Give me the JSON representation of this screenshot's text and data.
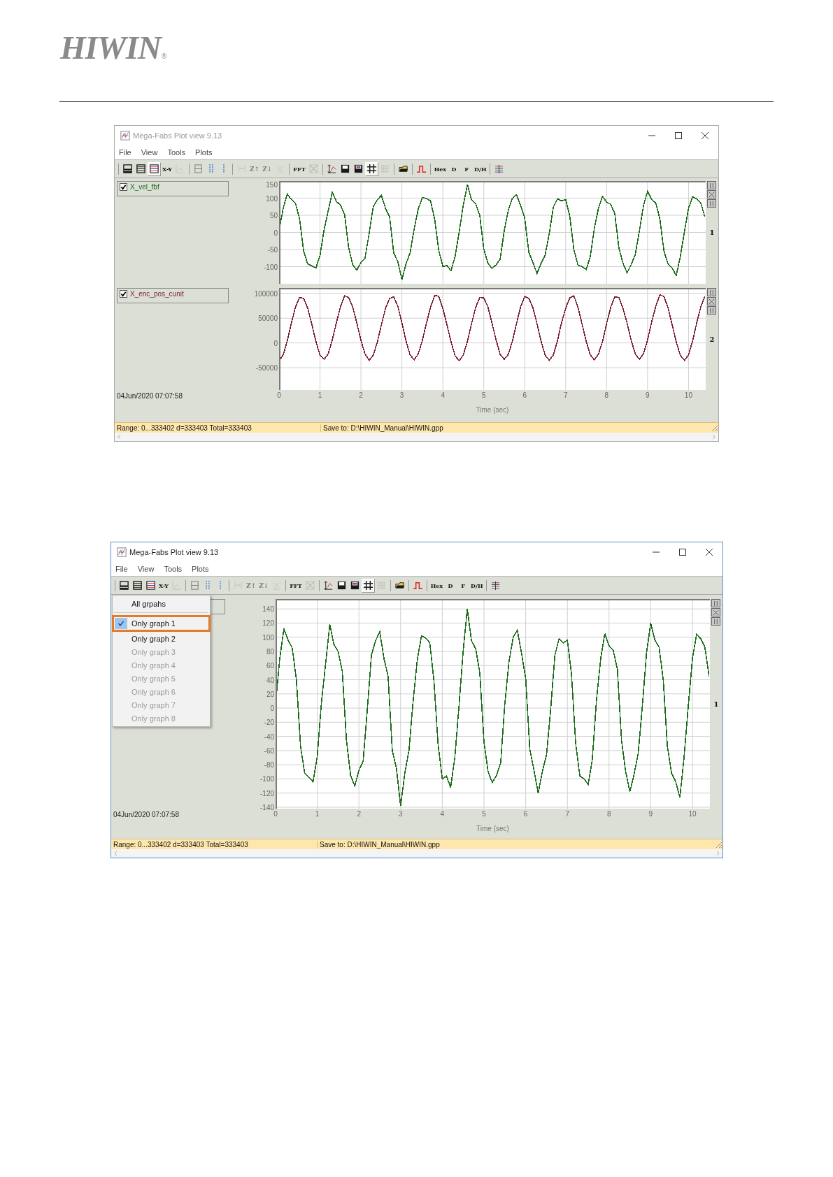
{
  "header": {
    "logo": "HIWIN",
    "logo_mark": "®"
  },
  "windows": [
    {
      "title": "Mega-Fabs Plot view 9.13",
      "active": false,
      "menus": [
        "File",
        "View",
        "Tools",
        "Plots"
      ],
      "toolbar": [
        [
          {
            "kind": "rows",
            "pressed": false,
            "disabled": false
          },
          {
            "kind": "lines",
            "pressed": false,
            "disabled": false
          },
          {
            "kind": "table",
            "pressed": true,
            "disabled": false
          },
          {
            "kind": "text",
            "label": "X-Y",
            "pressed": false,
            "disabled": false
          },
          {
            "kind": "chart",
            "pressed": false,
            "disabled": true
          }
        ],
        [
          {
            "kind": "split",
            "pressed": false,
            "disabled": false
          },
          {
            "kind": "dots",
            "pressed": false,
            "disabled": false
          },
          {
            "kind": "dot",
            "pressed": false,
            "disabled": false
          }
        ],
        [
          {
            "kind": "fit",
            "pressed": false,
            "disabled": true
          },
          {
            "kind": "text",
            "label": "Z↑",
            "pressed": false,
            "disabled": true
          },
          {
            "kind": "text",
            "label": "Z↓",
            "pressed": false,
            "disabled": true
          },
          {
            "kind": "unzoom",
            "pressed": false,
            "disabled": true
          }
        ],
        [
          {
            "kind": "text",
            "label": "FFT",
            "pressed": false,
            "disabled": false
          },
          {
            "kind": "cross",
            "pressed": false,
            "disabled": true
          }
        ],
        [
          {
            "kind": "scale",
            "pressed": false,
            "disabled": false
          },
          {
            "kind": "save",
            "pressed": false,
            "disabled": false
          },
          {
            "kind": "save-color",
            "pressed": false,
            "disabled": false
          },
          {
            "kind": "grid",
            "pressed": true,
            "disabled": false
          },
          {
            "kind": "grid-fine",
            "pressed": false,
            "disabled": true
          }
        ],
        [
          {
            "kind": "folder",
            "pressed": false,
            "disabled": false
          }
        ],
        [
          {
            "kind": "pulse",
            "pressed": false,
            "disabled": false
          }
        ],
        [
          {
            "kind": "text",
            "label": "Hex",
            "pressed": false,
            "disabled": false
          },
          {
            "kind": "text",
            "label": "D",
            "pressed": false,
            "disabled": false
          },
          {
            "kind": "text",
            "label": "F",
            "pressed": false,
            "disabled": false
          },
          {
            "kind": "text",
            "label": "D/H",
            "pressed": false,
            "disabled": false
          }
        ],
        [
          {
            "kind": "colors",
            "pressed": false,
            "disabled": false
          }
        ]
      ],
      "graphs": [
        {
          "legend": "X_vel_fbf",
          "checked": true,
          "number": "1",
          "chart_data": {
            "type": "line",
            "xlim": [
              0,
              10.42
            ],
            "ylim": [
              -150,
              150
            ],
            "grid": true,
            "yticks": [
              150,
              100,
              50,
              0,
              -50,
              -100
            ],
            "x": [
              0,
              0.1,
              0.2,
              0.3,
              0.4,
              0.5,
              0.6,
              0.7,
              0.8,
              0.9,
              1,
              1.1,
              1.2,
              1.3,
              1.4,
              1.5,
              1.6,
              1.7,
              1.8,
              1.9,
              2,
              2.1,
              2.2,
              2.3,
              2.4,
              2.5,
              2.6,
              2.7,
              2.8,
              2.9,
              3,
              3.1,
              3.2,
              3.3,
              3.4,
              3.5,
              3.6,
              3.7,
              3.8,
              3.9,
              4,
              4.1,
              4.2,
              4.3,
              4.4,
              4.5,
              4.6,
              4.7,
              4.8,
              4.9,
              5,
              5.1,
              5.2,
              5.3,
              5.4,
              5.5,
              5.6,
              5.7,
              5.8,
              5.9,
              6,
              6.1,
              6.2,
              6.3,
              6.4,
              6.5,
              6.6,
              6.7,
              6.8,
              6.9,
              7,
              7.1,
              7.2,
              7.3,
              7.4,
              7.5,
              7.6,
              7.7,
              7.8,
              7.9,
              8,
              8.1,
              8.2,
              8.3,
              8.4,
              8.5,
              8.6,
              8.7,
              8.8,
              8.9,
              9,
              9.1,
              9.2,
              9.3,
              9.4,
              9.5,
              9.6,
              9.7,
              9.8,
              9.9,
              10,
              10.1,
              10.2,
              10.3,
              10.4
            ],
            "series": [
              {
                "color": "#1b6b1b",
                "values": [
                  5,
                  70,
                  112,
                  96,
                  85,
                  40,
                  -55,
                  -92,
                  -98,
                  -104,
                  -68,
                  8,
                  62,
                  118,
                  90,
                  80,
                  52,
                  -45,
                  -95,
                  -110,
                  -88,
                  -75,
                  -3,
                  75,
                  95,
                  108,
                  70,
                  45,
                  -60,
                  -85,
                  -138,
                  -92,
                  -60,
                  10,
                  68,
                  102,
                  99,
                  92,
                  38,
                  -52,
                  -100,
                  -96,
                  -112,
                  -70,
                  2,
                  80,
                  140,
                  95,
                  84,
                  50,
                  -48,
                  -90,
                  -105,
                  -95,
                  -78,
                  6,
                  65,
                  100,
                  110,
                  78,
                  42,
                  -58,
                  -88,
                  -120,
                  -90,
                  -66,
                  -2,
                  74,
                  98,
                  92,
                  96,
                  48,
                  -50,
                  -96,
                  -100,
                  -108,
                  -72,
                  12,
                  70,
                  105,
                  88,
                  82,
                  55,
                  -46,
                  -90,
                  -118,
                  -94,
                  -64,
                  4,
                  78,
                  120,
                  96,
                  86,
                  40,
                  -54,
                  -92,
                  -104,
                  -126,
                  -70,
                  2,
                  70,
                  104,
                  98,
                  86,
                  45
                ]
              }
            ]
          }
        },
        {
          "legend": "X_enc_pos_cunit",
          "checked": true,
          "number": "2",
          "chart_data": {
            "type": "line",
            "xlim": [
              0,
              10.42
            ],
            "ylim": [
              -95000,
              111000
            ],
            "grid": true,
            "yticks": [
              100000,
              50000,
              0,
              -50000
            ],
            "xticks": [
              0,
              1,
              2,
              3,
              4,
              5,
              6,
              7,
              8,
              9,
              10
            ],
            "x": [
              0,
              0.1,
              0.2,
              0.3,
              0.4,
              0.5,
              0.6,
              0.7,
              0.8,
              0.9,
              1,
              1.1,
              1.2,
              1.3,
              1.4,
              1.5,
              1.6,
              1.7,
              1.8,
              1.9,
              2,
              2.1,
              2.2,
              2.3,
              2.4,
              2.5,
              2.6,
              2.7,
              2.8,
              2.9,
              3,
              3.1,
              3.2,
              3.3,
              3.4,
              3.5,
              3.6,
              3.7,
              3.8,
              3.9,
              4,
              4.1,
              4.2,
              4.3,
              4.4,
              4.5,
              4.6,
              4.7,
              4.8,
              4.9,
              5,
              5.1,
              5.2,
              5.3,
              5.4,
              5.5,
              5.6,
              5.7,
              5.8,
              5.9,
              6,
              6.1,
              6.2,
              6.3,
              6.4,
              6.5,
              6.6,
              6.7,
              6.8,
              6.9,
              7,
              7.1,
              7.2,
              7.3,
              7.4,
              7.5,
              7.6,
              7.7,
              7.8,
              7.9,
              8,
              8.1,
              8.2,
              8.3,
              8.4,
              8.5,
              8.6,
              8.7,
              8.8,
              8.9,
              9,
              9.1,
              9.2,
              9.3,
              9.4,
              9.5,
              9.6,
              9.7,
              9.8,
              9.9,
              10,
              10.1,
              10.2,
              10.3,
              10.4
            ],
            "series": [
              {
                "color": "#7a1e2e",
                "values": [
                  -36000,
                  -24000,
                  4000,
                  40000,
                  72000,
                  92000,
                  90000,
                  70000,
                  38000,
                  3000,
                  -25000,
                  -33000,
                  -22000,
                  6000,
                  41000,
                  73000,
                  95000,
                  92000,
                  72000,
                  40000,
                  5000,
                  -22000,
                  -35000,
                  -25000,
                  2000,
                  37000,
                  70000,
                  90000,
                  93000,
                  74000,
                  41000,
                  4000,
                  -24000,
                  -34000,
                  -22000,
                  5000,
                  40000,
                  72000,
                  96000,
                  94000,
                  70000,
                  37000,
                  2000,
                  -26000,
                  -36000,
                  -24000,
                  3000,
                  38000,
                  71000,
                  92000,
                  91000,
                  73000,
                  40000,
                  6000,
                  -23000,
                  -33000,
                  -23000,
                  4000,
                  39000,
                  73000,
                  94000,
                  90000,
                  71000,
                  39000,
                  3000,
                  -25000,
                  -35000,
                  -24000,
                  5000,
                  41000,
                  70000,
                  91000,
                  95000,
                  72000,
                  38000,
                  4000,
                  -24000,
                  -34000,
                  -23000,
                  3000,
                  39000,
                  72000,
                  93000,
                  92000,
                  70000,
                  40000,
                  5000,
                  -22000,
                  -33000,
                  -22000,
                  6000,
                  42000,
                  74000,
                  97000,
                  94000,
                  71000,
                  37000,
                  2000,
                  -25000,
                  -35000,
                  -24000,
                  4000,
                  40000,
                  73000,
                  94000
                ]
              }
            ]
          }
        }
      ],
      "timestamp": "04Jun/2020  07:07:58",
      "x_axis_title": "Time (sec)",
      "status": [
        "Range: 0...333402 d=333403 Total=333403",
        "Save to: D:\\HIWIN_Manual\\HIWIN.gpp"
      ]
    },
    {
      "title": "Mega-Fabs Plot view 9.13",
      "active": true,
      "menus": [
        "File",
        "View",
        "Tools",
        "Plots"
      ],
      "toolbar": [
        [
          {
            "kind": "rows",
            "pressed": false,
            "disabled": false
          },
          {
            "kind": "lines",
            "pressed": false,
            "disabled": false
          },
          {
            "kind": "table",
            "pressed": false,
            "disabled": false
          },
          {
            "kind": "text",
            "label": "X-Y",
            "pressed": false,
            "disabled": false
          },
          {
            "kind": "chart",
            "pressed": false,
            "disabled": true
          }
        ],
        [
          {
            "kind": "split",
            "pressed": false,
            "disabled": false
          },
          {
            "kind": "dots",
            "pressed": false,
            "disabled": false
          },
          {
            "kind": "dot",
            "pressed": false,
            "disabled": false
          }
        ],
        [
          {
            "kind": "fit",
            "pressed": false,
            "disabled": true
          },
          {
            "kind": "text",
            "label": "Z↑",
            "pressed": false,
            "disabled": true
          },
          {
            "kind": "text",
            "label": "Z↓",
            "pressed": false,
            "disabled": true
          },
          {
            "kind": "unzoom",
            "pressed": false,
            "disabled": true
          }
        ],
        [
          {
            "kind": "text",
            "label": "FFT",
            "pressed": false,
            "disabled": false
          },
          {
            "kind": "cross",
            "pressed": false,
            "disabled": true
          }
        ],
        [
          {
            "kind": "scale",
            "pressed": false,
            "disabled": false
          },
          {
            "kind": "save",
            "pressed": false,
            "disabled": false
          },
          {
            "kind": "save-color",
            "pressed": false,
            "disabled": false
          },
          {
            "kind": "grid",
            "pressed": true,
            "disabled": false
          },
          {
            "kind": "grid-fine",
            "pressed": false,
            "disabled": true
          }
        ],
        [
          {
            "kind": "folder",
            "pressed": false,
            "disabled": false
          }
        ],
        [
          {
            "kind": "pulse",
            "pressed": false,
            "disabled": false
          }
        ],
        [
          {
            "kind": "text",
            "label": "Hex",
            "pressed": false,
            "disabled": false
          },
          {
            "kind": "text",
            "label": "D",
            "pressed": false,
            "disabled": false
          },
          {
            "kind": "text",
            "label": "F",
            "pressed": false,
            "disabled": false
          },
          {
            "kind": "text",
            "label": "D/H",
            "pressed": false,
            "disabled": false
          }
        ],
        [
          {
            "kind": "colors",
            "pressed": false,
            "disabled": false
          }
        ]
      ],
      "dropdown": [
        [
          {
            "label": "All grpahs",
            "checked": false,
            "disabled": false,
            "highlighted": false
          }
        ],
        [
          {
            "label": "Only graph 1",
            "checked": true,
            "disabled": false,
            "highlighted": true
          },
          {
            "label": "Only graph 2",
            "checked": false,
            "disabled": false,
            "highlighted": false
          },
          {
            "label": "Only graph 3",
            "checked": false,
            "disabled": true,
            "highlighted": false
          },
          {
            "label": "Only graph 4",
            "checked": false,
            "disabled": true,
            "highlighted": false
          },
          {
            "label": "Only graph 5",
            "checked": false,
            "disabled": true,
            "highlighted": false
          },
          {
            "label": "Only graph 6",
            "checked": false,
            "disabled": true,
            "highlighted": false
          },
          {
            "label": "Only graph 7",
            "checked": false,
            "disabled": true,
            "highlighted": false
          },
          {
            "label": "Only graph 8",
            "checked": false,
            "disabled": true,
            "highlighted": false
          }
        ]
      ],
      "graphs": [
        {
          "number": "1",
          "chart_data": {
            "type": "line",
            "xlim": [
              0,
              10.42
            ],
            "ylim": [
              -142,
              154
            ],
            "grid": true,
            "yticks": [
              140,
              120,
              100,
              80,
              60,
              40,
              20,
              0,
              -20,
              -40,
              -60,
              -80,
              -100,
              -120,
              -140
            ],
            "xticks": [
              0,
              1,
              2,
              3,
              4,
              5,
              6,
              7,
              8,
              9,
              10
            ],
            "x": [
              0,
              0.1,
              0.2,
              0.3,
              0.4,
              0.5,
              0.6,
              0.7,
              0.8,
              0.9,
              1,
              1.1,
              1.2,
              1.3,
              1.4,
              1.5,
              1.6,
              1.7,
              1.8,
              1.9,
              2,
              2.1,
              2.2,
              2.3,
              2.4,
              2.5,
              2.6,
              2.7,
              2.8,
              2.9,
              3,
              3.1,
              3.2,
              3.3,
              3.4,
              3.5,
              3.6,
              3.7,
              3.8,
              3.9,
              4,
              4.1,
              4.2,
              4.3,
              4.4,
              4.5,
              4.6,
              4.7,
              4.8,
              4.9,
              5,
              5.1,
              5.2,
              5.3,
              5.4,
              5.5,
              5.6,
              5.7,
              5.8,
              5.9,
              6,
              6.1,
              6.2,
              6.3,
              6.4,
              6.5,
              6.6,
              6.7,
              6.8,
              6.9,
              7,
              7.1,
              7.2,
              7.3,
              7.4,
              7.5,
              7.6,
              7.7,
              7.8,
              7.9,
              8,
              8.1,
              8.2,
              8.3,
              8.4,
              8.5,
              8.6,
              8.7,
              8.8,
              8.9,
              9,
              9.1,
              9.2,
              9.3,
              9.4,
              9.5,
              9.6,
              9.7,
              9.8,
              9.9,
              10,
              10.1,
              10.2,
              10.3,
              10.4
            ],
            "series": [
              {
                "color": "#1b6b1b",
                "values": [
                  5,
                  70,
                  112,
                  96,
                  85,
                  40,
                  -55,
                  -92,
                  -98,
                  -104,
                  -68,
                  8,
                  62,
                  118,
                  90,
                  80,
                  52,
                  -45,
                  -95,
                  -110,
                  -88,
                  -75,
                  -3,
                  75,
                  95,
                  108,
                  70,
                  45,
                  -60,
                  -85,
                  -138,
                  -92,
                  -60,
                  10,
                  68,
                  102,
                  99,
                  92,
                  38,
                  -52,
                  -100,
                  -96,
                  -112,
                  -70,
                  2,
                  80,
                  140,
                  95,
                  84,
                  50,
                  -48,
                  -90,
                  -105,
                  -95,
                  -78,
                  6,
                  65,
                  100,
                  110,
                  78,
                  42,
                  -58,
                  -88,
                  -120,
                  -90,
                  -66,
                  -2,
                  74,
                  98,
                  92,
                  96,
                  48,
                  -50,
                  -96,
                  -100,
                  -108,
                  -72,
                  12,
                  70,
                  105,
                  88,
                  82,
                  55,
                  -46,
                  -90,
                  -118,
                  -94,
                  -64,
                  4,
                  78,
                  120,
                  96,
                  86,
                  40,
                  -54,
                  -92,
                  -104,
                  -126,
                  -70,
                  2,
                  70,
                  104,
                  98,
                  86,
                  45
                ]
              }
            ]
          }
        }
      ],
      "timestamp": "04Jun/2020  07:07:58",
      "x_axis_title": "Time (sec)",
      "status": [
        "Range: 0...333402 d=333403 Total=333403",
        "Save to: D:\\HIWIN_Manual\\HIWIN.gpp"
      ]
    }
  ]
}
